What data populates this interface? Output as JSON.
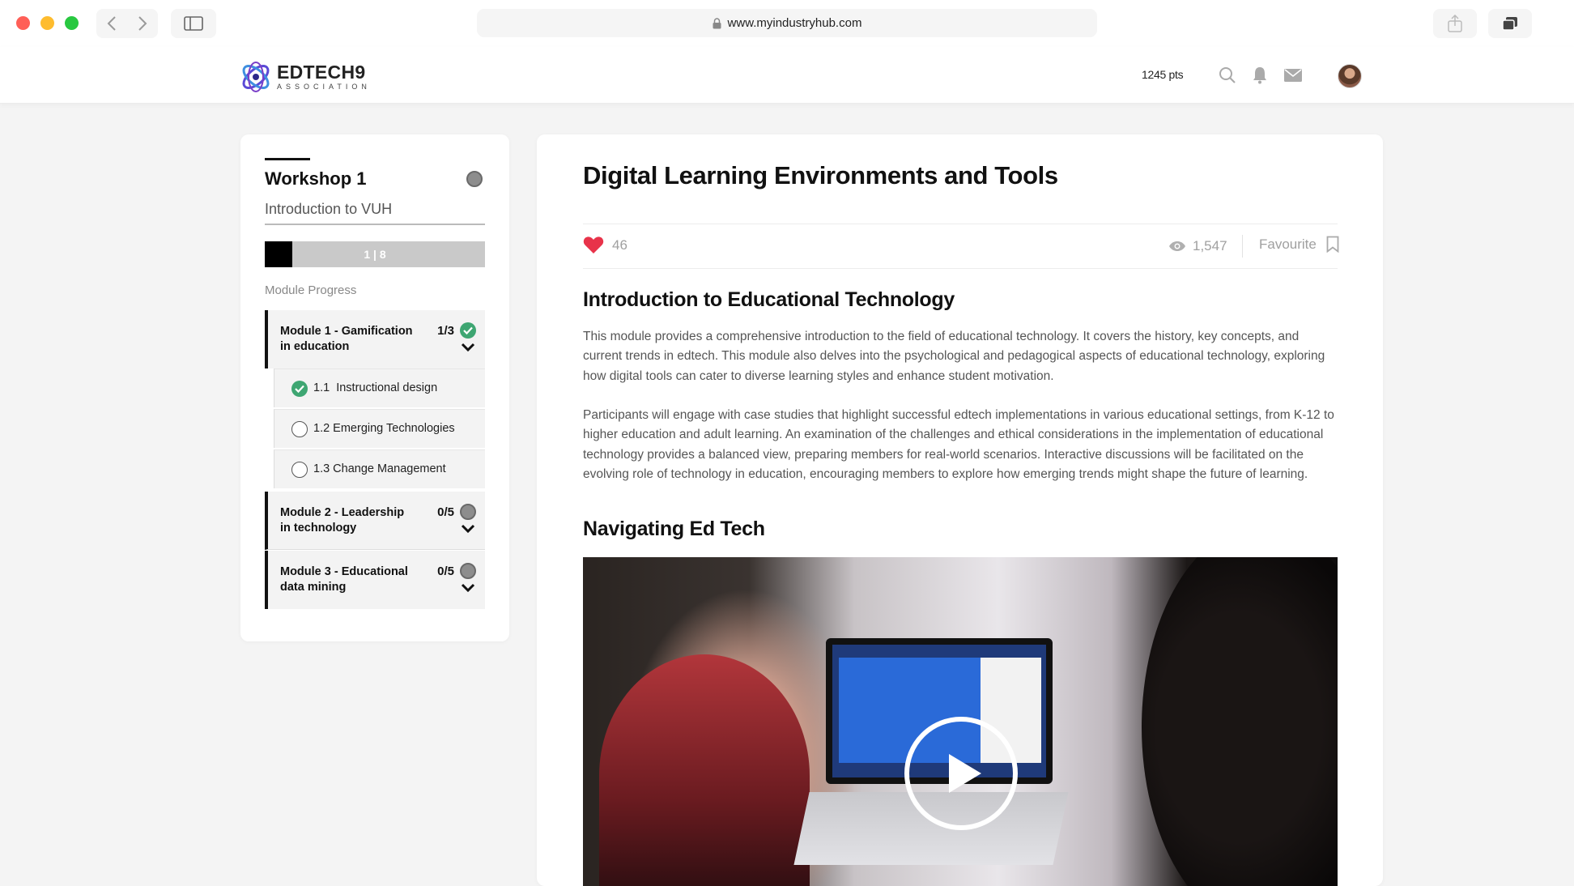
{
  "browser": {
    "url": "www.myindustryhub.com"
  },
  "header": {
    "logo_name": "EDTECH9",
    "logo_sub": "ASSOCIATION",
    "points": "1245 pts"
  },
  "sidebar": {
    "workshop_title": "Workshop 1",
    "workshop_subtitle": "Introduction to VUH",
    "progress_label": "1 | 8",
    "progress_fraction": 0.125,
    "module_progress_label": "Module Progress",
    "modules": [
      {
        "title": "Module 1 - Gamification in education",
        "count": "1/3",
        "status": "done",
        "lessons": [
          {
            "label": "1.1  Instructional design",
            "status": "done"
          },
          {
            "label": "1.2 Emerging Technologies",
            "status": "todo"
          },
          {
            "label": "1.3 Change Management",
            "status": "todo"
          }
        ]
      },
      {
        "title": "Module 2 - Leadership in technology",
        "count": "0/5",
        "status": "todo"
      },
      {
        "title": "Module 3 - Educational data mining",
        "count": "0/5",
        "status": "todo"
      }
    ]
  },
  "content": {
    "title": "Digital Learning Environments and Tools",
    "likes": "46",
    "views": "1,547",
    "favourite_label": "Favourite",
    "section1_title": "Introduction to Educational Technology",
    "para1": "This module provides a comprehensive introduction to the field of educational technology. It covers the history, key concepts, and current trends in edtech. This module also delves into the psychological and pedagogical aspects of educational technology, exploring how digital tools can cater to diverse learning styles and enhance student motivation.",
    "para2": "Participants will engage with case studies that highlight successful edtech implementations in various educational settings, from K-12 to higher education and adult learning. An examination of the challenges and ethical considerations in the implementation of educational technology provides a balanced view, preparing members for real-world scenarios. Interactive discussions will be facilitated on the evolving role of technology in education, encouraging members to explore how emerging trends might shape the future of learning.",
    "section2_title": "Navigating Ed Tech"
  },
  "colors": {
    "accent_heart": "#e8334a",
    "done_green": "#3ea672",
    "todo_grey": "#8d8d8d"
  },
  "icons": [
    "back-icon",
    "forward-icon",
    "sidebar-icon",
    "lock-icon",
    "share-icon",
    "tabs-icon",
    "search-icon",
    "bell-icon",
    "mail-icon",
    "heart-icon",
    "eye-icon",
    "bookmark-icon",
    "check-icon",
    "chevron-down-icon",
    "play-icon"
  ]
}
